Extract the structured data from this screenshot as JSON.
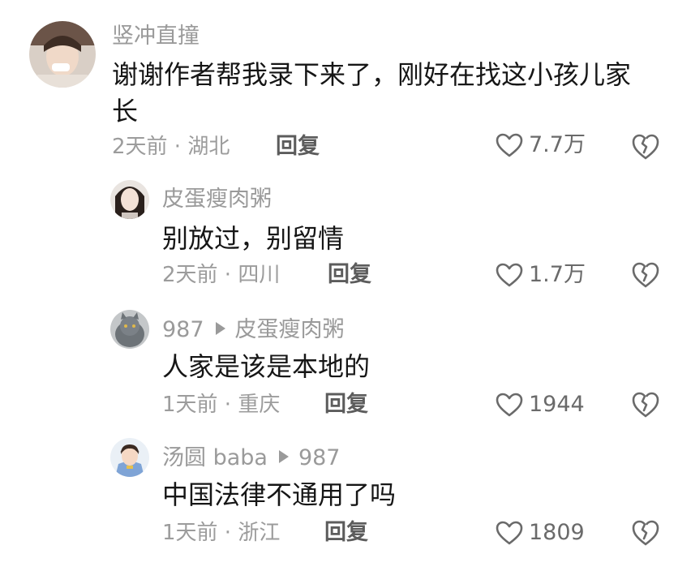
{
  "comments": [
    {
      "username": "竖冲直撞",
      "content": "谢谢作者帮我录下来了，刚好在找这小孩儿家长",
      "meta": "2天前 · 湖北",
      "reply": "回复",
      "likes": "7.7万",
      "avatar_icon": "user-avatar-photo"
    },
    {
      "username": "皮蛋瘦肉粥",
      "content": "别放过，别留情",
      "meta": "2天前 · 四川",
      "reply": "回复",
      "likes": "1.7万",
      "avatar_icon": "user-avatar-photo"
    },
    {
      "username": "987",
      "reply_to": "皮蛋瘦肉粥",
      "content": "人家是该是本地的",
      "meta": "1天前 · 重庆",
      "reply": "回复",
      "likes": "1944",
      "avatar_icon": "cat-avatar-photo"
    },
    {
      "username": "汤圆 baba",
      "reply_to": "987",
      "content": "中国法律不通用了吗",
      "meta": "1天前 · 浙江",
      "reply": "回复",
      "likes": "1809",
      "avatar_icon": "cartoon-prince-avatar"
    }
  ],
  "icons": {
    "like": "heart-outline-icon",
    "dislike": "broken-heart-icon",
    "reply_arrow": "triangle-right-icon"
  },
  "colors": {
    "username": "#9a9a9a",
    "content": "#161616",
    "meta": "#9c9c9c",
    "reply": "#5c5c5c",
    "icon": "#6a6a6a"
  }
}
